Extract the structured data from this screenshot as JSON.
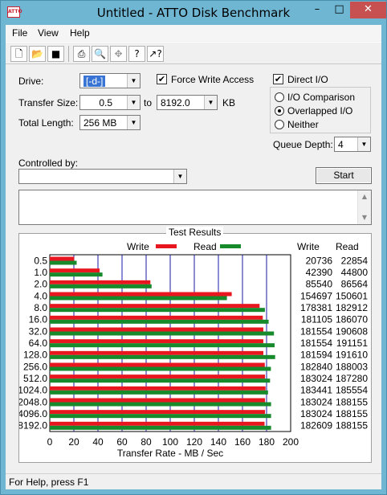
{
  "window": {
    "title": "Untitled - ATTO Disk Benchmark",
    "app_icon_text": "ATTO",
    "minimize": "–",
    "maximize": "□",
    "close": "✕"
  },
  "menu": {
    "items": [
      "File",
      "View",
      "Help"
    ]
  },
  "toolbar": {
    "icons": [
      "new-icon",
      "open-icon",
      "save-icon",
      "print-icon",
      "print-preview-icon",
      "move-icon",
      "help-icon",
      "context-help-icon"
    ]
  },
  "settings": {
    "drive_label": "Drive:",
    "drive_value": "[-d-]",
    "force_write_label": "Force Write Access",
    "force_write_checked": true,
    "direct_io_label": "Direct I/O",
    "direct_io_checked": true,
    "transfer_size_label": "Transfer Size:",
    "transfer_from": "0.5",
    "to_label": "to",
    "transfer_to": "8192.0",
    "kb_label": "KB",
    "total_length_label": "Total Length:",
    "total_length_value": "256 MB",
    "io_mode_options": [
      "I/O Comparison",
      "Overlapped I/O",
      "Neither"
    ],
    "io_mode_selected": "Overlapped I/O",
    "queue_depth_label": "Queue Depth:",
    "queue_depth_value": "4",
    "controlled_by_label": "Controlled by:",
    "controlled_by_value": "",
    "start_button": "Start"
  },
  "results": {
    "group_title": "Test Results",
    "legend_write": "Write",
    "legend_read": "Read",
    "col_write": "Write",
    "col_read": "Read",
    "xlabel": "Transfer Rate - MB / Sec",
    "write_color": "#e8171f",
    "read_color": "#178a2c"
  },
  "chart_data": {
    "type": "bar",
    "title": "Test Results",
    "xlabel": "Transfer Rate - MB / Sec",
    "xlim": [
      0,
      200
    ],
    "xticks": [
      0,
      20,
      40,
      60,
      80,
      100,
      120,
      140,
      160,
      180,
      200
    ],
    "categories": [
      "0.5",
      "1.0",
      "2.0",
      "4.0",
      "8.0",
      "16.0",
      "32.0",
      "64.0",
      "128.0",
      "256.0",
      "512.0",
      "1024.0",
      "2048.0",
      "4096.0",
      "8192.0"
    ],
    "series": [
      {
        "name": "Write",
        "values": [
          20736,
          42390,
          85540,
          154697,
          178381,
          181105,
          181554,
          181554,
          181594,
          182840,
          183024,
          183441,
          183024,
          183024,
          182609
        ]
      },
      {
        "name": "Read",
        "values": [
          22854,
          44800,
          86564,
          150601,
          182912,
          186070,
          190608,
          191151,
          191610,
          188003,
          187280,
          185554,
          188155,
          188155,
          188155
        ]
      }
    ],
    "grid": true,
    "legend": "top-center"
  },
  "status": {
    "text": "For Help, press F1"
  }
}
